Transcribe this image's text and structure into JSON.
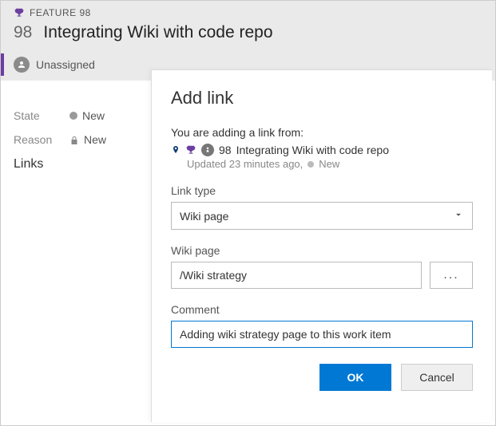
{
  "workItem": {
    "typeLabel": "FEATURE 98",
    "id": "98",
    "title": "Integrating Wiki with code repo",
    "assignee": "Unassigned",
    "state": {
      "label": "State",
      "value": "New"
    },
    "reason": {
      "label": "Reason",
      "value": "New"
    },
    "linksSection": "Links"
  },
  "dialog": {
    "title": "Add link",
    "intro": "You are adding a link from:",
    "sourceId": "98",
    "sourceTitle": "Integrating Wiki with code repo",
    "metaUpdated": "Updated 23 minutes ago,",
    "metaState": "New",
    "linkType": {
      "label": "Link type",
      "value": "Wiki page"
    },
    "wikiPage": {
      "label": "Wiki page",
      "value": "/Wiki strategy",
      "browse": "..."
    },
    "comment": {
      "label": "Comment",
      "value": "Adding wiki strategy page to this work item"
    },
    "ok": "OK",
    "cancel": "Cancel"
  }
}
